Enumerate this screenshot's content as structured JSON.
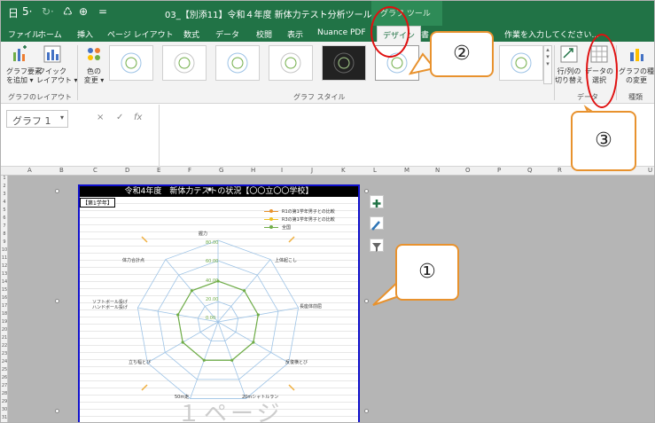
{
  "window": {
    "title": "03_【別添11】令和４年度 新体力テスト分析ツール.xlsx - Excel",
    "contextual_tab_group": "グラフ ツール"
  },
  "qat": {
    "save_glyph": "日",
    "undo_glyph": "5·",
    "redo_glyph": "↻·",
    "print_glyph": "♺",
    "custom_glyph": "⊕",
    "more_glyph": "="
  },
  "tabs": [
    "ファイル",
    "ホーム",
    "挿入",
    "ページ レイアウト",
    "数式",
    "データ",
    "校閲",
    "表示",
    "Nuance PDF",
    "デザイン",
    "書"
  ],
  "tellme": "作業を入力してください...",
  "ribbon": {
    "add_element": "グラフ要素\nを追加 ▾",
    "quick_layout": "クイック\nレイアウト ▾",
    "change_color": "色の\n変更 ▾",
    "group_layouts": "グラフのレイアウト",
    "group_styles": "グラフ スタイル",
    "switch_row_col": "行/列の\n切り替え",
    "select_data": "データの\n選択",
    "change_type": "グラフの種類\nの変更",
    "group_data": "データ",
    "group_type": "種類"
  },
  "formula_bar": {
    "name_box": "グラフ 1",
    "name_dropdown": "▾",
    "cancel": "×",
    "enter": "✓",
    "fx": "fx",
    "value": ""
  },
  "grid": {
    "columns": [
      "A",
      "B",
      "C",
      "D",
      "E",
      "F",
      "G",
      "H",
      "I",
      "J",
      "K",
      "L",
      "M",
      "N",
      "O",
      "P",
      "Q",
      "R",
      "U"
    ],
    "rows": [
      "1",
      "2",
      "3",
      "4",
      "5",
      "6",
      "7",
      "8",
      "9",
      "10",
      "11",
      "12",
      "13",
      "14",
      "15",
      "16",
      "17",
      "18",
      "19",
      "20",
      "21",
      "22",
      "23",
      "24",
      "25",
      "26",
      "27",
      "28",
      "29",
      "30",
      "31"
    ]
  },
  "chart": {
    "title": "令和4年度　新体力テストの状況【〇〇立〇〇学校】",
    "grade_label": "【第1学年】",
    "watermark": "１ページ",
    "legend": [
      {
        "label": "R1の第1学年男子との比較",
        "color": "#e8922e"
      },
      {
        "label": "R3の第1学年男子との比較",
        "color": "#f0c020"
      },
      {
        "label": "全国",
        "color": "#70ad47"
      }
    ],
    "axes": [
      "握力",
      "上体起こし",
      "長座体前屈",
      "反復横とび",
      "20mシャトルラン",
      "50m走",
      "立ち幅とび",
      "ソフトボール投げ\nハンドボール投げ",
      "体力合計点"
    ],
    "scale": [
      "80.00",
      "60.00",
      "40.00",
      "20.00",
      "0.00"
    ]
  },
  "chart_tools": {
    "add": "+",
    "style": "brush",
    "filter": "funnel"
  },
  "callouts": {
    "one": "①",
    "two": "②",
    "three": "③"
  },
  "colors": {
    "excel_green": "#217346",
    "chart_border": "#1010cc",
    "callout_border": "#e8922e",
    "annotation_red": "#e01010",
    "radar_grid": "#9dc3e6",
    "radar_series": "#70ad47"
  }
}
